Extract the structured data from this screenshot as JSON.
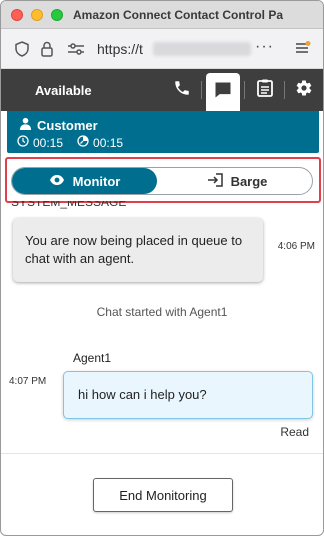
{
  "window": {
    "title": "Amazon Connect Contact Control Pa"
  },
  "browser": {
    "url": "https://t"
  },
  "header": {
    "status": "Available"
  },
  "contact": {
    "name": "Customer",
    "timer1": "00:15",
    "timer2": "00:15",
    "color": "#006f8f"
  },
  "modes": {
    "monitor_label": "Monitor",
    "barge_label": "Barge",
    "selected": "Monitor"
  },
  "chat": {
    "system_label": "SYSTEM_MESSAGE",
    "system_message": "You are now being placed in queue to chat with an agent.",
    "system_time": "4:06 PM",
    "chat_started": "Chat started with  Agent1",
    "agent_name": "Agent1",
    "agent_message": "hi how can i help you?",
    "agent_time": "4:07 PM",
    "read_receipt": "Read"
  },
  "footer": {
    "end_button": "End Monitoring"
  },
  "icons": [
    "shield-icon",
    "lock-icon",
    "site-settings-icon",
    "more-icon",
    "browser-menu-icon",
    "phone-icon",
    "chat-icon",
    "clipboard-icon",
    "gear-icon",
    "person-icon",
    "clock-icon",
    "timer-icon",
    "eye-icon",
    "enter-icon"
  ]
}
